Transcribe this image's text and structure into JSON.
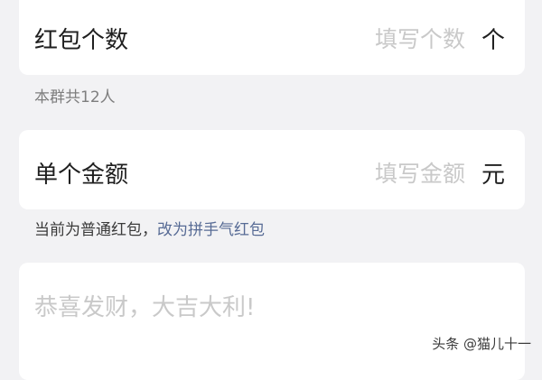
{
  "count_row": {
    "label": "红包个数",
    "placeholder": "填写个数",
    "unit": "个"
  },
  "member_info": "本群共12人",
  "amount_row": {
    "label": "单个金额",
    "placeholder": "填写金额",
    "unit": "元"
  },
  "type_info": {
    "text": "当前为普通红包，",
    "link": "改为拼手气红包"
  },
  "greeting": {
    "placeholder": "恭喜发财，大吉大利!"
  },
  "watermark": "头条 @猫儿十一",
  "colors": {
    "background": "#f2f2f4",
    "card": "#ffffff",
    "link": "#576b95",
    "placeholder": "#c9c9c9"
  }
}
